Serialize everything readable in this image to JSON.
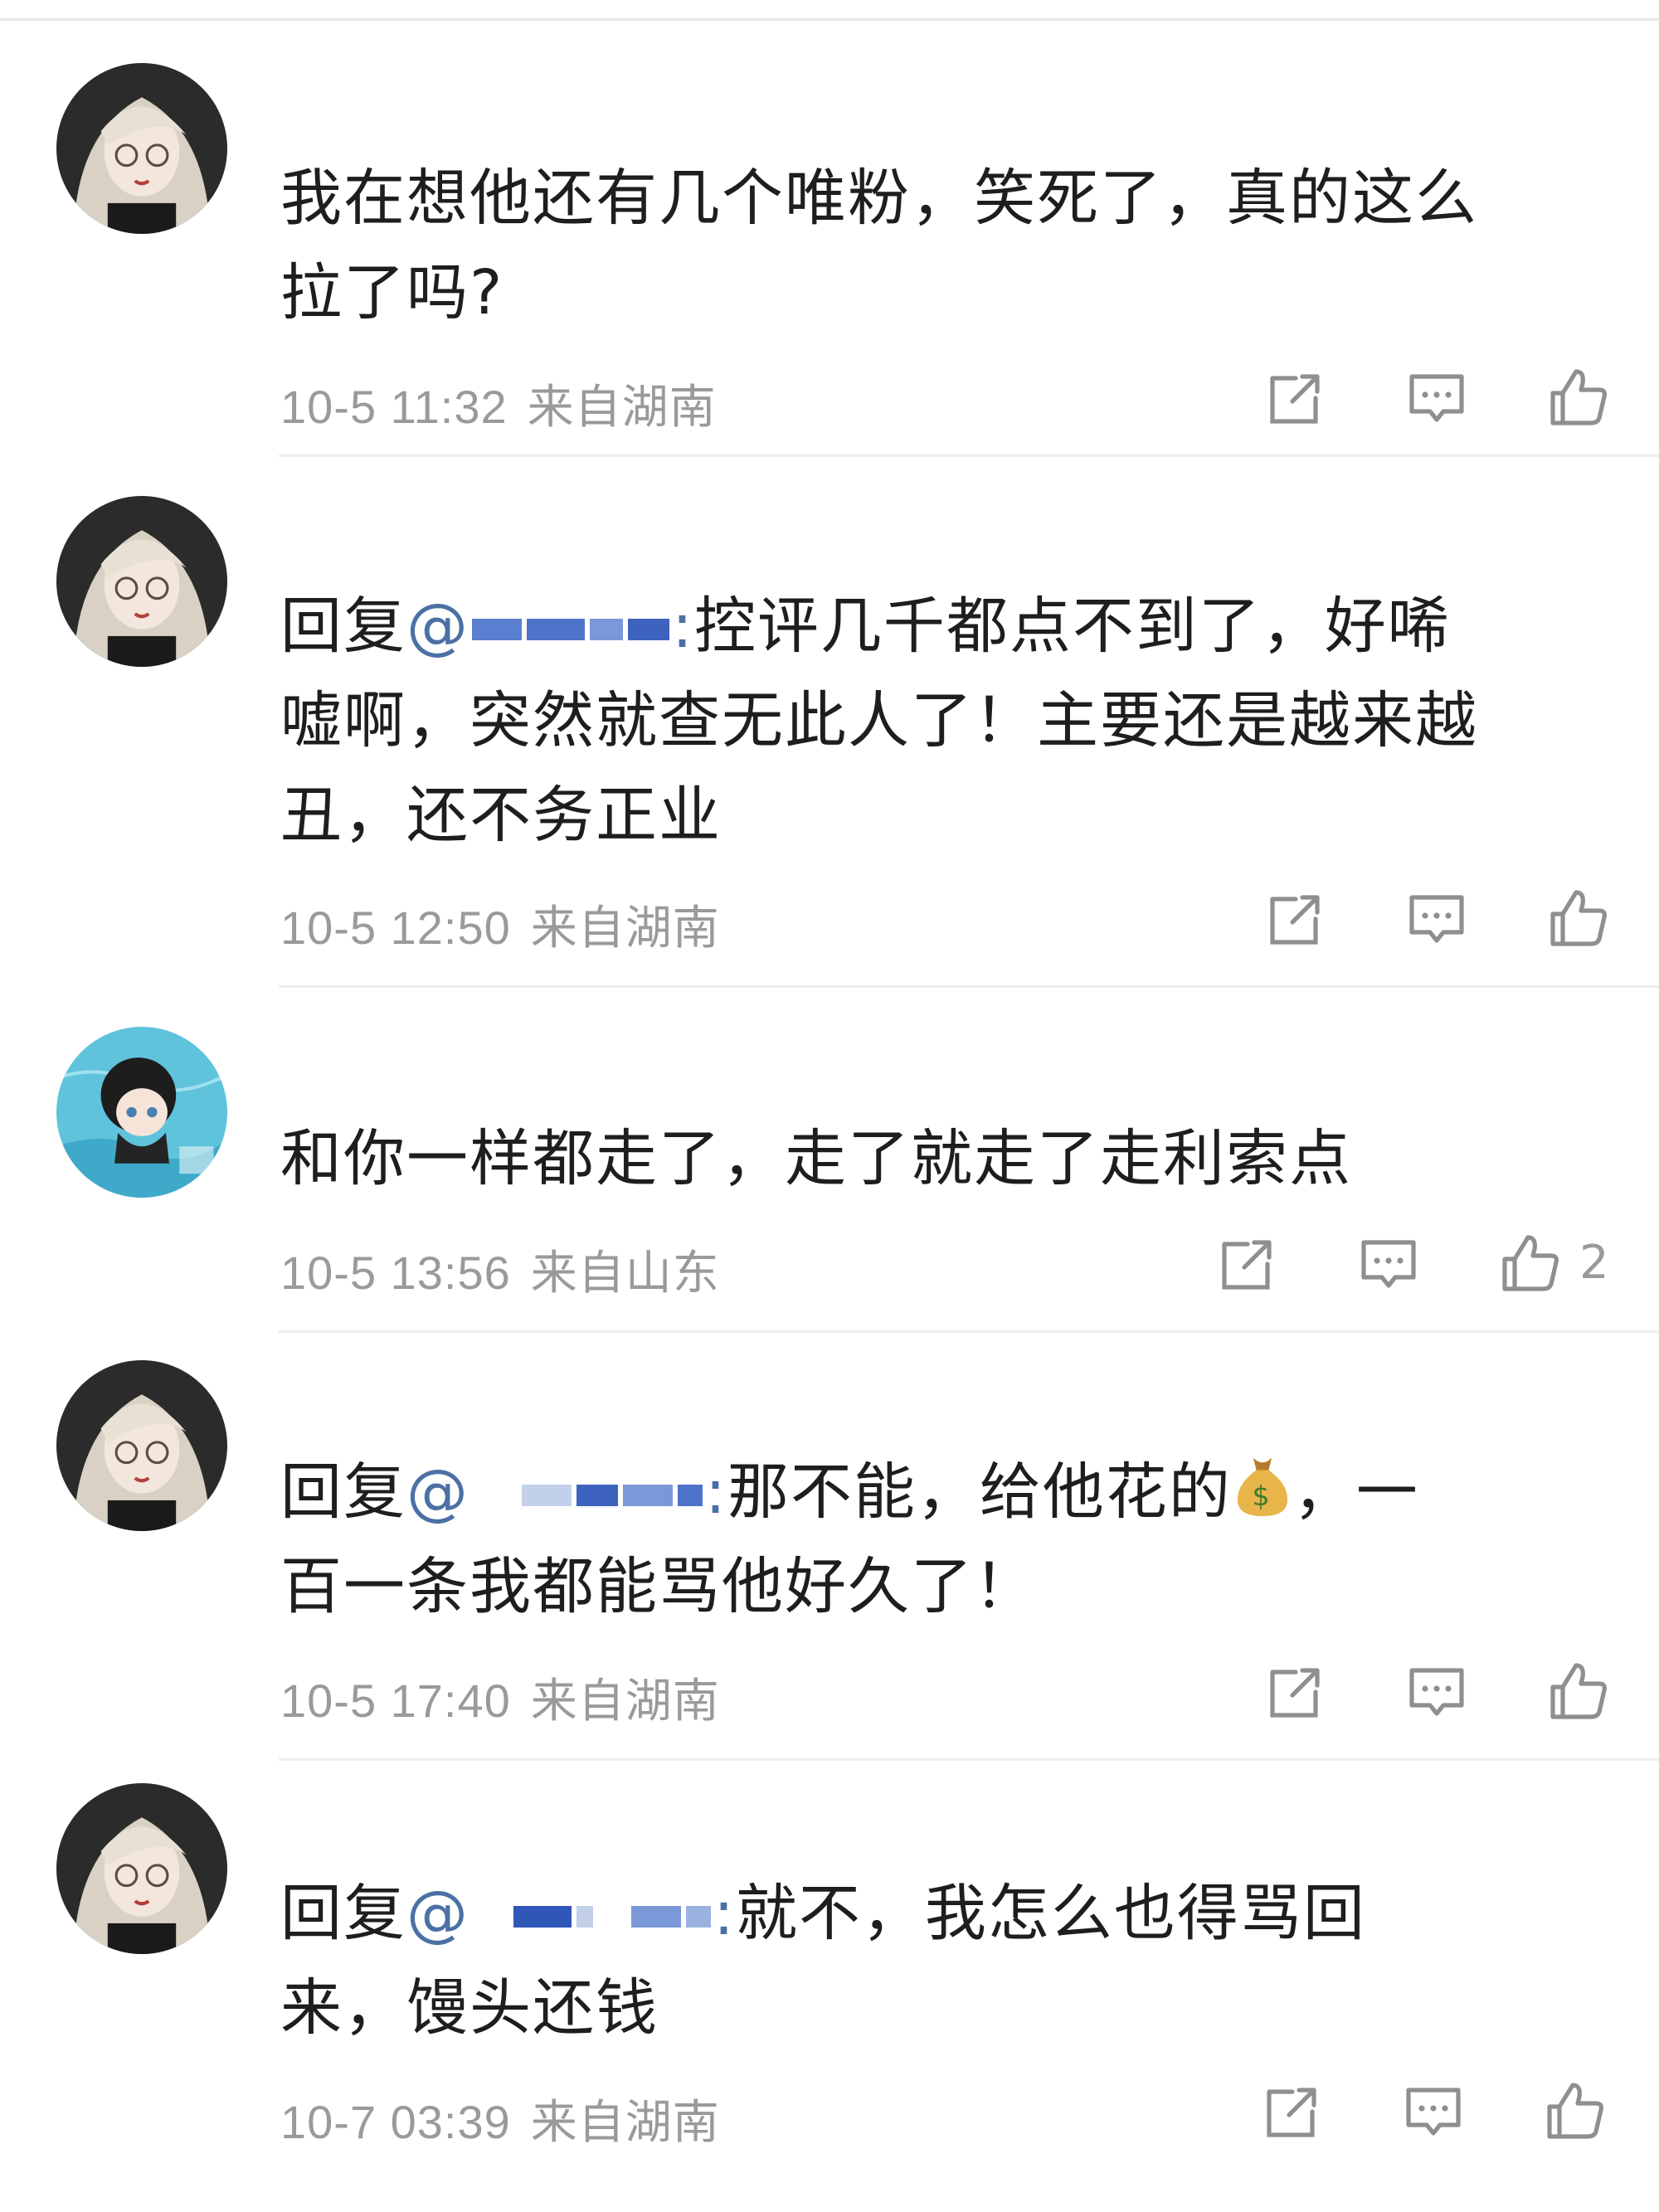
{
  "comments": [
    {
      "text_lines": [
        "我在想他还有几个唯粉，笑死了，真的这么",
        "拉了吗?"
      ],
      "date": "10-5 11:32",
      "location": "来自湖南",
      "likes": ""
    },
    {
      "reply_prefix": "回复",
      "at": "@",
      "mention_suffix": ":",
      "text_after_mention": "控评几千都点不到了，好唏",
      "text_lines": [
        "嘘啊，突然就查无此人了！主要还是越来越",
        "丑，还不务正业"
      ],
      "date": "10-5 12:50",
      "location": "来自湖南",
      "likes": ""
    },
    {
      "text_lines": [
        "和你一样都走了，走了就走了走利索点"
      ],
      "date": "10-5 13:56",
      "location": "来自山东",
      "likes": "2"
    },
    {
      "reply_prefix": "回复",
      "at": "@",
      "mention_suffix": ":",
      "text_after_mention": "那不能，给他花的",
      "text_after_emoji": "，一",
      "text_lines": [
        "百一条我都能骂他好久了！"
      ],
      "date": "10-5 17:40",
      "location": "来自湖南",
      "likes": ""
    },
    {
      "reply_prefix": "回复",
      "at": "@",
      "mention_suffix": ":",
      "text_after_mention": "就不，我怎么也得骂回",
      "text_lines": [
        "来，馒头还钱"
      ],
      "date": "10-7 03:39",
      "location": "来自湖南",
      "likes": ""
    }
  ],
  "icons": {
    "share": "share-icon",
    "comment": "comment-icon",
    "like": "thumbs-up-icon",
    "emoji": "money-bag-emoji"
  },
  "colors": {
    "mention": "#4b70a5",
    "meta": "#9a9a9a",
    "icon": "#8f8f8f"
  }
}
